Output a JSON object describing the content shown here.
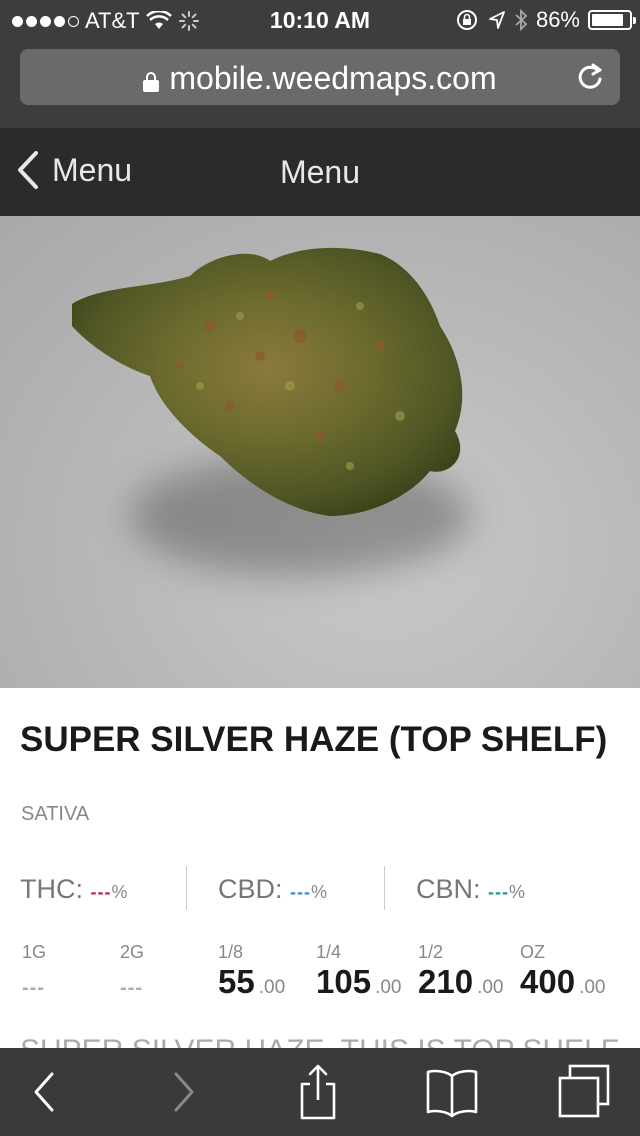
{
  "status_bar": {
    "carrier": "AT&T",
    "time": "10:10 AM",
    "battery": "86%",
    "battery_level": 0.86
  },
  "browser": {
    "url": "mobile.weedmaps.com"
  },
  "nav": {
    "back_label": "Menu",
    "title": "Menu"
  },
  "product": {
    "name": "SUPER SILVER HAZE (TOP SHELF)",
    "type": "SATIVA",
    "cannabinoids": [
      {
        "label": "THC:",
        "value": "---",
        "unit": "%",
        "color": "#c0204a"
      },
      {
        "label": "CBD:",
        "value": "---",
        "unit": "%",
        "color": "#2a8fd0"
      },
      {
        "label": "CBN:",
        "value": "---",
        "unit": "%",
        "color": "#1a9a8a"
      }
    ],
    "prices": [
      {
        "label": "1G",
        "value": "---",
        "cents": ""
      },
      {
        "label": "2G",
        "value": "---",
        "cents": ""
      },
      {
        "label": "1/8",
        "value": "55",
        "cents": ".00"
      },
      {
        "label": "1/4",
        "value": "105",
        "cents": ".00"
      },
      {
        "label": "1/2",
        "value": "210",
        "cents": ".00"
      },
      {
        "label": "OZ",
        "value": "400",
        "cents": ".00"
      }
    ],
    "description_partial": "SUPER SILVER HAZE. THIS IS TOP SHELF"
  },
  "toolbar": {
    "icons": [
      "back-icon",
      "forward-icon",
      "share-icon",
      "bookmarks-icon",
      "tabs-icon"
    ]
  }
}
